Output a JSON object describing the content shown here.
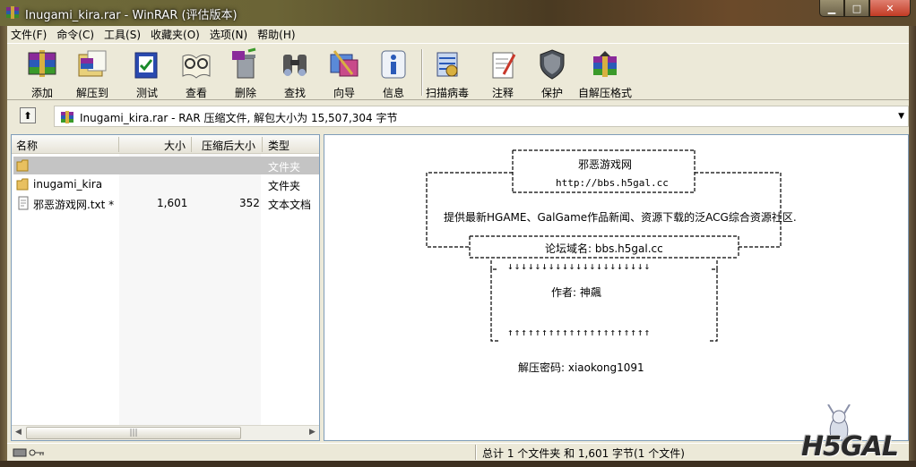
{
  "window": {
    "title": "Inugami_kira.rar - WinRAR (评估版本)"
  },
  "menu": [
    "文件(F)",
    "命令(C)",
    "工具(S)",
    "收藏夹(O)",
    "选项(N)",
    "帮助(H)"
  ],
  "toolbar": [
    {
      "label": "添加",
      "icon": "add-archive-icon"
    },
    {
      "label": "解压到",
      "icon": "extract-to-icon"
    },
    {
      "label": "测试",
      "icon": "test-icon"
    },
    {
      "label": "查看",
      "icon": "view-icon"
    },
    {
      "label": "删除",
      "icon": "delete-icon"
    },
    {
      "label": "查找",
      "icon": "find-icon"
    },
    {
      "label": "向导",
      "icon": "wizard-icon"
    },
    {
      "label": "信息",
      "icon": "info-icon"
    },
    {
      "label": "扫描病毒",
      "icon": "virus-scan-icon"
    },
    {
      "label": "注释",
      "icon": "comment-icon"
    },
    {
      "label": "保护",
      "icon": "protect-icon"
    },
    {
      "label": "自解压格式",
      "icon": "sfx-icon"
    }
  ],
  "address": {
    "text": "Inugami_kira.rar - RAR 压缩文件, 解包大小为 15,507,304 字节"
  },
  "columns": [
    "名称",
    "大小",
    "压缩后大小",
    "类型"
  ],
  "files": [
    {
      "name": "",
      "size": "",
      "packed": "",
      "type": "文件夹",
      "icon": "folder-icon",
      "selected": true
    },
    {
      "name": "inugami_kira",
      "size": "",
      "packed": "",
      "type": "文件夹",
      "icon": "folder-icon",
      "selected": false
    },
    {
      "name": "邪恶游戏网.txt *",
      "size": "1,601",
      "packed": "352",
      "type": "文本文档",
      "icon": "text-file-icon",
      "selected": false
    }
  ],
  "comment": {
    "site_name": "邪恶游戏网",
    "site_url": "http://bbs.h5gal.cc",
    "description": "提供最新HGAME、GalGame作品新闻、资源下载的泛ACG综合资源社区.",
    "forum_domain": "论坛域名: bbs.h5gal.cc",
    "author": "作者: 神飆",
    "password": "解压密码: xiaokong1091",
    "down_arrows": "↓↓↓↓↓↓↓↓↓↓↓↓↓↓↓↓↓↓↓↓↓",
    "up_arrows": "↑↑↑↑↑↑↑↑↑↑↑↑↑↑↑↑↑↑↑↑↑"
  },
  "status": {
    "text": "总计 1 个文件夹 和 1,601 字节(1 个文件)"
  },
  "watermark": {
    "text": "H5GAL"
  }
}
